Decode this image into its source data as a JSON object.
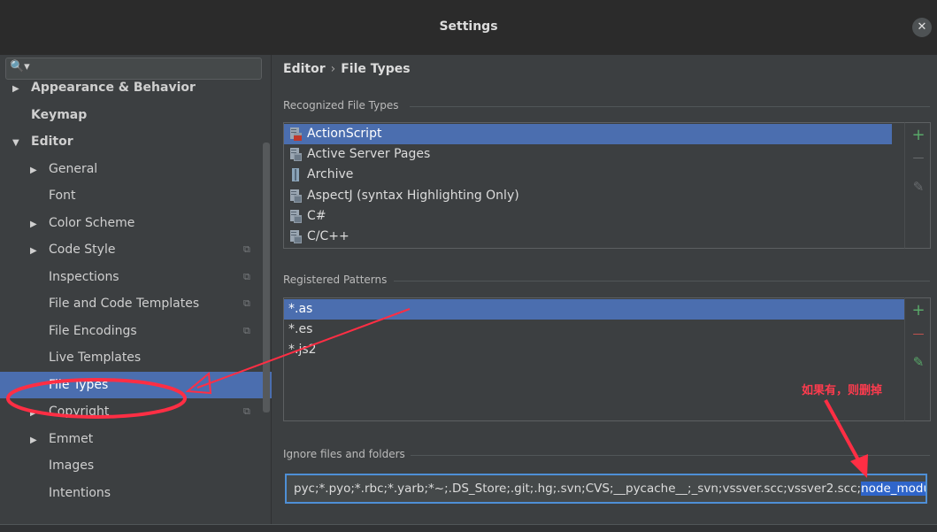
{
  "window": {
    "title": "Settings",
    "close_glyph": "✕"
  },
  "search": {
    "glyph": "🔍▾",
    "placeholder": ""
  },
  "tree": [
    {
      "label": "Appearance & Behavior",
      "arrow": "▶",
      "bold": true
    },
    {
      "label": "Keymap",
      "arrow": "",
      "bold": true
    },
    {
      "label": "Editor",
      "arrow": "▼",
      "bold": true
    },
    {
      "label": "General",
      "arrow": "▶"
    },
    {
      "label": "Font",
      "arrow": ""
    },
    {
      "label": "Color Scheme",
      "arrow": "▶"
    },
    {
      "label": "Code Style",
      "arrow": "▶",
      "copy": true
    },
    {
      "label": "Inspections",
      "arrow": "",
      "copy": true
    },
    {
      "label": "File and Code Templates",
      "arrow": "",
      "copy": true
    },
    {
      "label": "File Encodings",
      "arrow": "",
      "copy": true
    },
    {
      "label": "Live Templates",
      "arrow": ""
    },
    {
      "label": "File Types",
      "arrow": "",
      "selected": true
    },
    {
      "label": "Copyright",
      "arrow": "▶",
      "copy": true
    },
    {
      "label": "Emmet",
      "arrow": "▶"
    },
    {
      "label": "Images",
      "arrow": ""
    },
    {
      "label": "Intentions",
      "arrow": ""
    }
  ],
  "breadcrumb": {
    "parent": "Editor",
    "separator": "›",
    "current": "File Types"
  },
  "recognized": {
    "label": "Recognized File Types",
    "items": [
      {
        "name": "ActionScript",
        "icon": "actionscript-file-icon",
        "selected": true
      },
      {
        "name": "Active Server Pages",
        "icon": "asp-file-icon"
      },
      {
        "name": "Archive",
        "icon": "archive-file-icon"
      },
      {
        "name": "AspectJ (syntax Highlighting Only)",
        "icon": "aspectj-file-icon"
      },
      {
        "name": "C#",
        "icon": "csharp-file-icon"
      },
      {
        "name": "C/C++",
        "icon": "cpp-file-icon"
      }
    ]
  },
  "patterns": {
    "label": "Registered Patterns",
    "items": [
      {
        "name": "*.as",
        "selected": true
      },
      {
        "name": "*.es"
      },
      {
        "name": "*.js2"
      }
    ]
  },
  "tools": {
    "add": "+",
    "remove": "—",
    "edit": "✎"
  },
  "ignore": {
    "label": "Ignore files and folders",
    "value_plain": "pyc;*.pyo;*.rbc;*.yarb;*~;.DS_Store;.git;.hg;.svn;CVS;__pycache__;_svn;vssver.scc;vssver2.scc;",
    "value_selected": "node_modules;"
  },
  "annotation": {
    "text": "如果有，则删掉",
    "color": "#ff3b4e"
  },
  "colors": {
    "selection": "#4b6eaf",
    "add": "#59a869",
    "remove": "#c75450",
    "annotation": "#ff2e44"
  }
}
